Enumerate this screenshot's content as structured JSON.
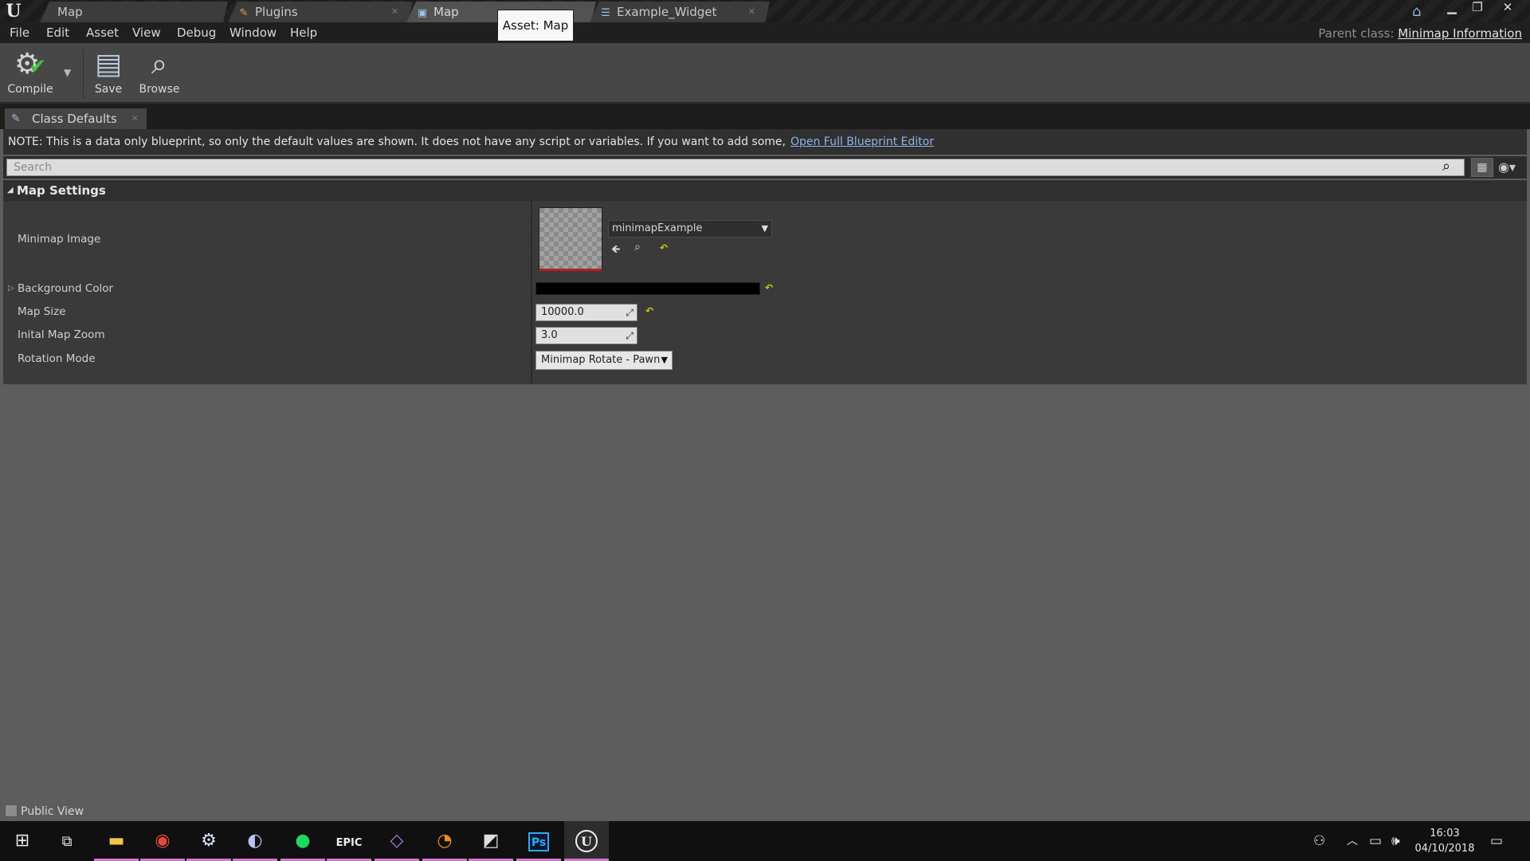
{
  "tabs": [
    {
      "label": "Map",
      "icon": "map-icon"
    },
    {
      "label": "Plugins",
      "icon": "plug-icon"
    },
    {
      "label": "Map",
      "icon": "blueprint-icon"
    },
    {
      "label": "Example_Widget",
      "icon": "widget-icon"
    }
  ],
  "tooltip": "Asset: Map",
  "menu": [
    "File",
    "Edit",
    "Asset",
    "View",
    "Debug",
    "Window",
    "Help"
  ],
  "parent_class": {
    "label": "Parent class:",
    "value": "Minimap Information"
  },
  "toolbar": {
    "compile": "Compile",
    "save": "Save",
    "browse": "Browse"
  },
  "panel_tab": "Class Defaults",
  "note": {
    "text": "NOTE: This is a data only blueprint, so only the default values are shown.  It does not have any script or variables.  If you want to add some,",
    "link": "Open Full Blueprint Editor"
  },
  "search": {
    "placeholder": "Search"
  },
  "category": "Map Settings",
  "properties": {
    "minimap_image": {
      "label": "Minimap Image",
      "value": "minimapExample"
    },
    "background_color": {
      "label": "Background Color",
      "value": "#000000"
    },
    "map_size": {
      "label": "Map Size",
      "value": "10000.0"
    },
    "initial_map_zoom": {
      "label": "Inital Map Zoom",
      "value": "3.0"
    },
    "rotation_mode": {
      "label": "Rotation Mode",
      "value": "Minimap Rotate - Pawn"
    }
  },
  "public_view": "Public View",
  "taskbar": {
    "apps": [
      "file-explorer-icon",
      "chrome-icon",
      "steam-icon",
      "discord-icon",
      "spotify-icon",
      "epic-games-icon",
      "visual-studio-icon",
      "blender-icon",
      "unity-icon",
      "photoshop-icon",
      "unreal-engine-icon"
    ],
    "epic_label": "EPIC",
    "ps_label": "Ps",
    "time": "16:03",
    "date": "04/10/2018"
  },
  "colors": {
    "accent_link": "#8fb2e8",
    "reset_yellow": "#d4c21c",
    "thumb_red": "#b81e1e"
  }
}
